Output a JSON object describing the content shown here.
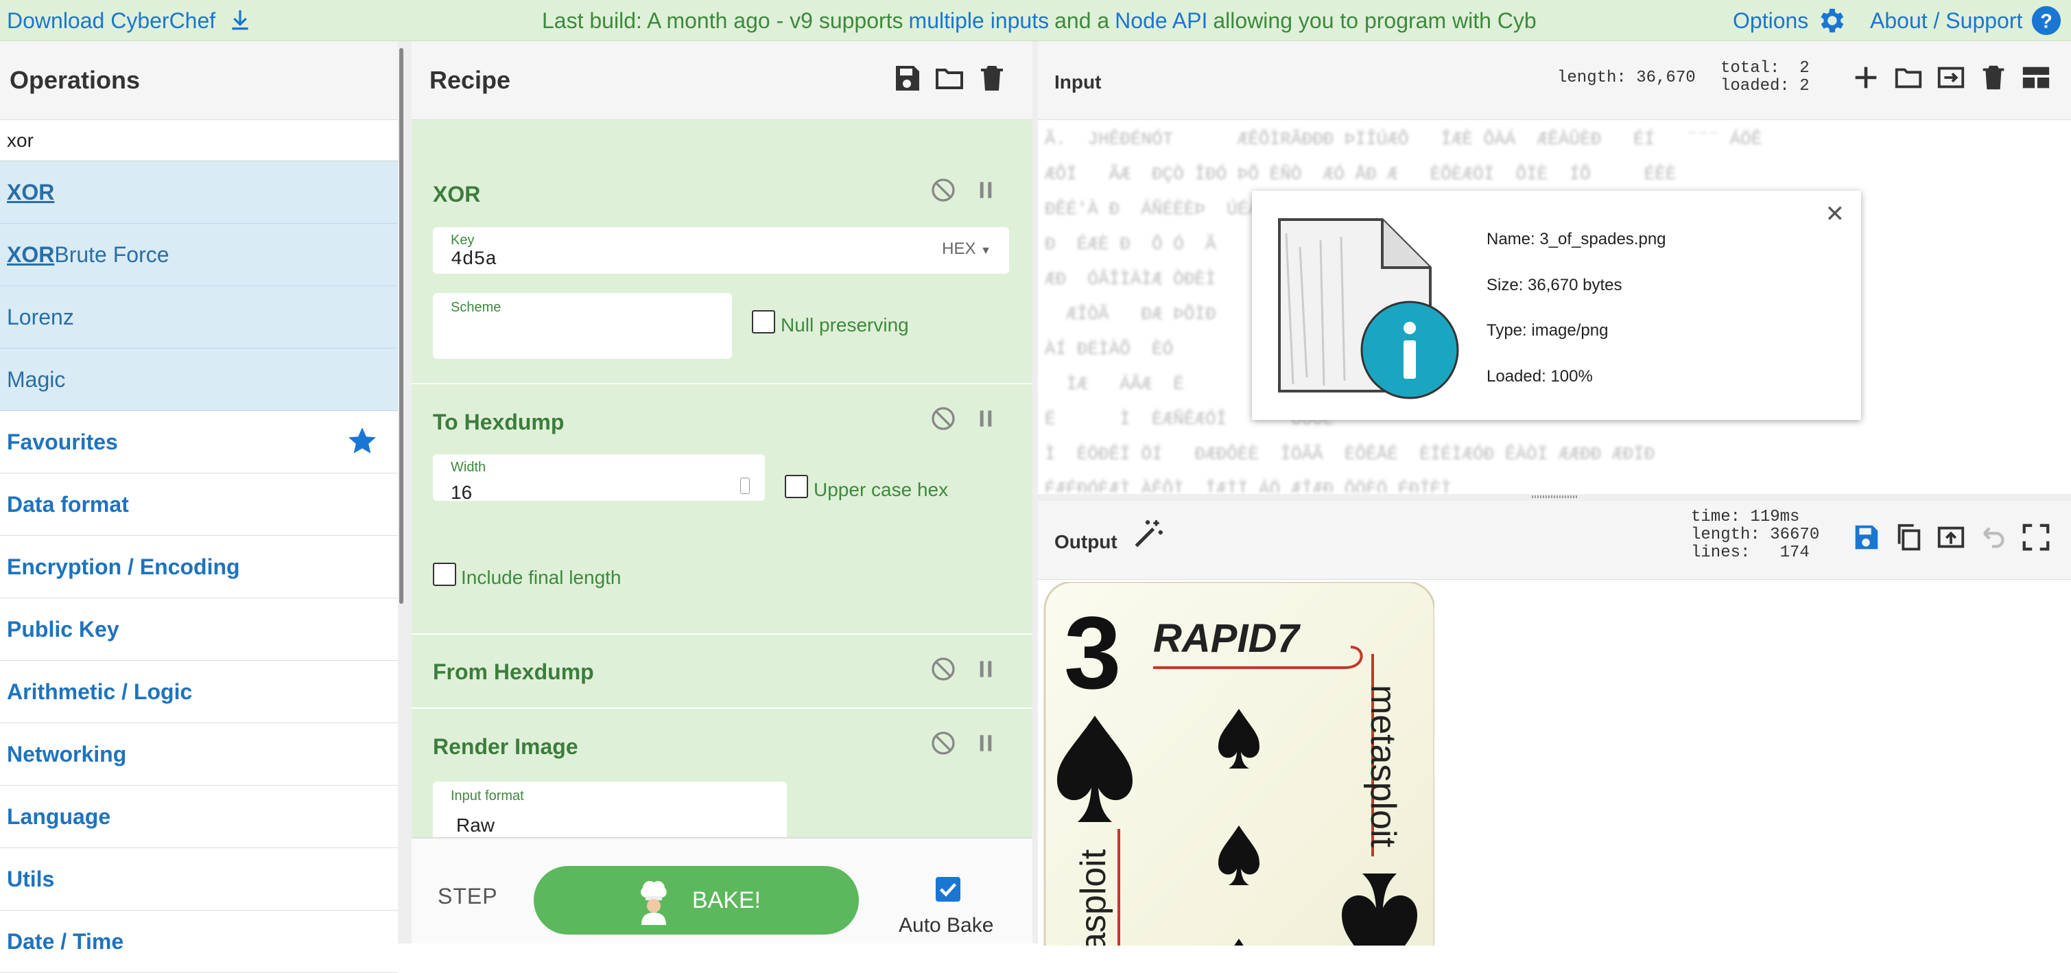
{
  "banner": {
    "download": "Download CyberChef",
    "msg_pre": "Last build: A month ago - v9 supports",
    "msg_link1": "multiple inputs",
    "msg_mid": "and a",
    "msg_link2": "Node API",
    "msg_post": "allowing you to program with Cyb…",
    "options": "Options",
    "about": "About / Support"
  },
  "operations": {
    "title": "Operations",
    "search_value": "xor",
    "results": [
      {
        "bold": "XOR",
        "rest": ""
      },
      {
        "bold": "XOR",
        "rest": " Brute Force"
      },
      {
        "bold": "",
        "rest": "Lorenz"
      },
      {
        "bold": "",
        "rest": "Magic"
      }
    ],
    "categories": [
      "Favourites",
      "Data format",
      "Encryption / Encoding",
      "Public Key",
      "Arithmetic / Logic",
      "Networking",
      "Language",
      "Utils",
      "Date / Time"
    ]
  },
  "recipe": {
    "title": "Recipe",
    "xor": {
      "title": "XOR",
      "key_label": "Key",
      "key_value": "4d5a",
      "key_format": "HEX",
      "scheme_label": "Scheme",
      "null_preserving": "Null preserving"
    },
    "hexdump": {
      "title": "To Hexdump",
      "width_label": "Width",
      "width_value": "16",
      "upper_case": "Upper case hex",
      "final_length": "Include final length"
    },
    "from_hexdump": {
      "title": "From Hexdump"
    },
    "render_image": {
      "title": "Render Image",
      "format_label": "Input format",
      "format_value": "Raw"
    },
    "footer": {
      "step": "STEP",
      "bake": "BAKE!",
      "auto_bake": "Auto Bake"
    }
  },
  "input": {
    "title": "Input",
    "length": "length: 36,670",
    "total": "total:  2",
    "loaded": "loaded: 2",
    "file": {
      "name": "Name: 3_of_spades.png",
      "size": "Size: 36,670 bytes",
      "type": "Type: image/png",
      "loaded": "Loaded: 100%"
    }
  },
  "output": {
    "title": "Output",
    "time": "time: 119ms",
    "length": "length: 36670",
    "lines": "lines:   174"
  },
  "card": {
    "rank": "3",
    "brand": "RAPID7",
    "vertical": "metasploit",
    "vertical_cut": "asploit"
  },
  "colors": {
    "accent": "#1976d2",
    "banner_bg": "#dff0d8",
    "ingredient_bg": "#dff0d8",
    "ingredient_title": "#3c7d3c",
    "bake_green": "#5cb85c",
    "result_bg": "#d9ebf5"
  }
}
